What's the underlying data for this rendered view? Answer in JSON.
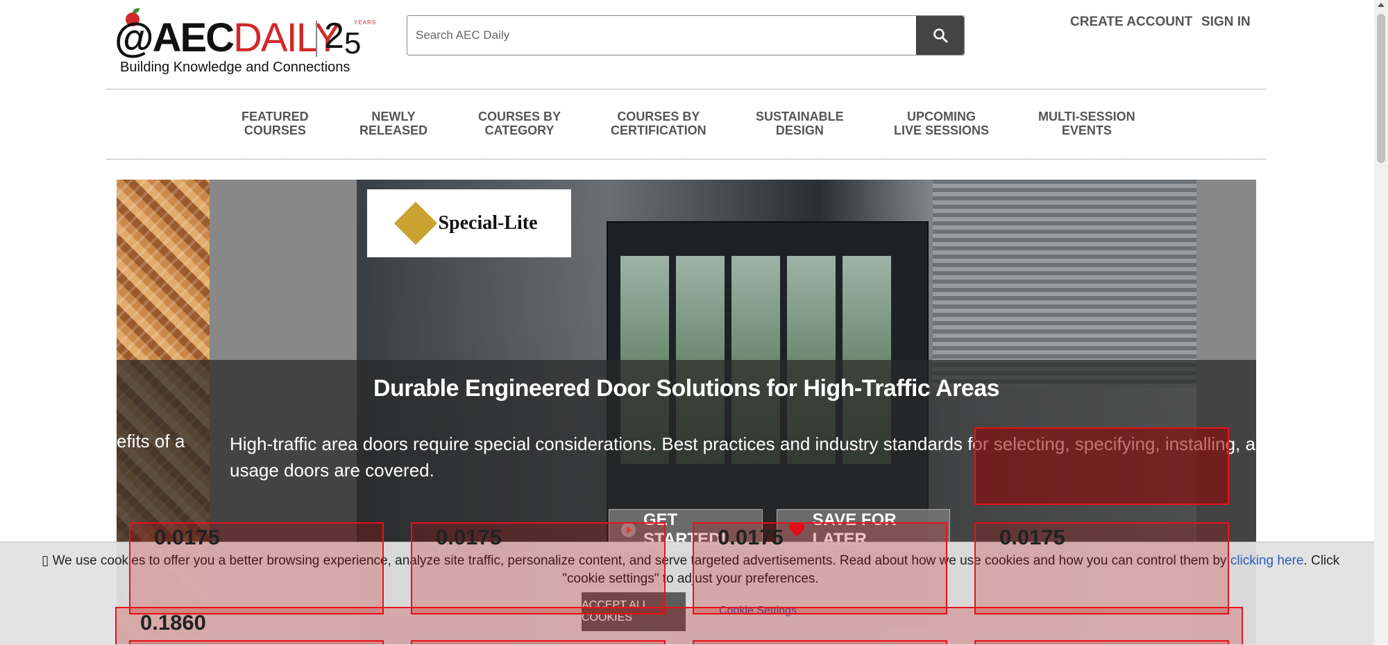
{
  "header": {
    "logo": {
      "at": "@",
      "aec": "AEC",
      "daily": "DAILY",
      "anniversary_2": "2",
      "anniversary_5": "5",
      "years": "YEARS"
    },
    "tagline": "Building Knowledge and Connections",
    "search": {
      "placeholder": "Search AEC Daily",
      "button_icon": "search-icon"
    },
    "create_account": "CREATE ACCOUNT",
    "sign_in": "SIGN IN"
  },
  "nav": [
    {
      "line1": "FEATURED",
      "line2": "COURSES"
    },
    {
      "line1": "NEWLY",
      "line2": "RELEASED"
    },
    {
      "line1": "COURSES BY",
      "line2": "CATEGORY"
    },
    {
      "line1": "COURSES BY",
      "line2": "CERTIFICATION"
    },
    {
      "line1": "SUSTAINABLE",
      "line2": "DESIGN"
    },
    {
      "line1": "UPCOMING",
      "line2": "LIVE SESSIONS"
    },
    {
      "line1": "MULTI-SESSION",
      "line2": "EVENTS"
    }
  ],
  "hero": {
    "sponsor": "Special-Lite",
    "title": "Durable Engineered Door Solutions for High-Traffic Areas",
    "prev_fragment": "efits of a",
    "description_line1": "High-traffic area doors require special considerations. Best practices and industry standards for selecting, specifying, installing, and maintaini",
    "description_line2": "usage doors are covered.",
    "get_started": "GET STARTED!",
    "save_for_later": "SAVE FOR LATER",
    "colors": {
      "band": "#282828",
      "button": "#787878"
    }
  },
  "overlays": {
    "labels": [
      "0.0175",
      "0.0175",
      "0.0175",
      "0.0175",
      "0.1860"
    ],
    "color": "#e8121b"
  },
  "cookie": {
    "text_before": "We use cookies to offer you a better browsing experience, analyze site traffic, personalize content, and serve targeted advertisements. Read about how we use cookies and how you can control them by ",
    "link": "clicking here",
    "text_after": ". Click \"cookie settings\" to adjust your preferences.",
    "accept": "ACCEPT ALL COOKIES",
    "settings": "Cookie Settings"
  }
}
